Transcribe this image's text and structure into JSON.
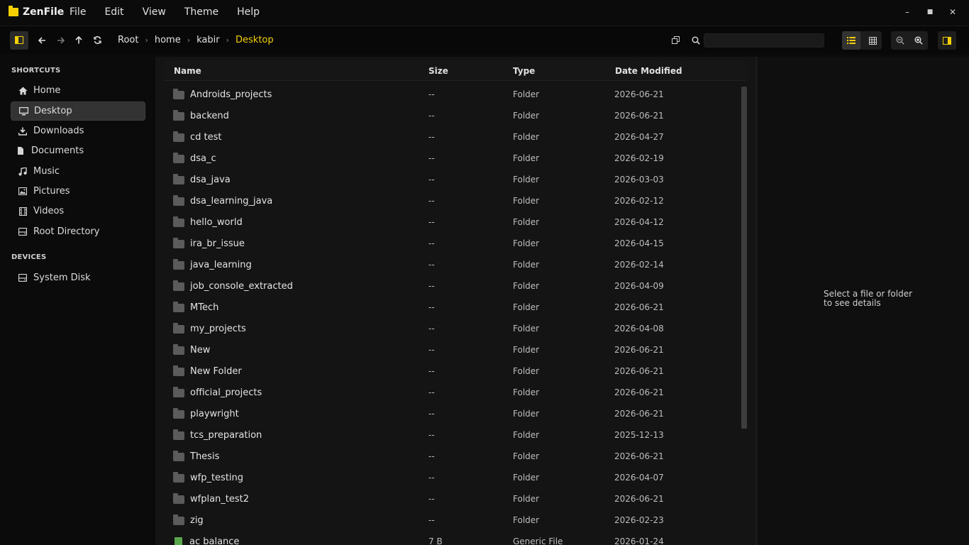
{
  "app": {
    "name": "ZenFile"
  },
  "menu": [
    "File",
    "Edit",
    "View",
    "Theme",
    "Help"
  ],
  "window_controls": {
    "minimize": "–",
    "maximize": "■",
    "close": "✕"
  },
  "breadcrumb": [
    "Root",
    "home",
    "kabir",
    "Desktop"
  ],
  "search": {
    "value": "",
    "placeholder": ""
  },
  "sidebar": {
    "shortcuts_title": "SHORTCUTS",
    "shortcuts": [
      {
        "label": "Home",
        "icon": "home-icon"
      },
      {
        "label": "Desktop",
        "icon": "desktop-icon",
        "active": true
      },
      {
        "label": "Downloads",
        "icon": "download-icon"
      },
      {
        "label": "Documents",
        "icon": "document-icon"
      },
      {
        "label": "Music",
        "icon": "music-icon"
      },
      {
        "label": "Pictures",
        "icon": "image-icon"
      },
      {
        "label": "Videos",
        "icon": "video-icon"
      },
      {
        "label": "Root Directory",
        "icon": "root-directory-icon"
      }
    ],
    "devices_title": "DEVICES",
    "devices": [
      {
        "label": "System Disk",
        "icon": "disk-icon"
      }
    ]
  },
  "list": {
    "headers": {
      "name": "Name",
      "size": "Size",
      "type": "Type",
      "date": "Date Modified"
    },
    "rows": [
      {
        "name": "Androids_projects",
        "size": "--",
        "type": "Folder",
        "date": "2026-06-21",
        "kind": "folder"
      },
      {
        "name": "backend",
        "size": "--",
        "type": "Folder",
        "date": "2026-06-21",
        "kind": "folder"
      },
      {
        "name": "cd test",
        "size": "--",
        "type": "Folder",
        "date": "2026-04-27",
        "kind": "folder"
      },
      {
        "name": "dsa_c",
        "size": "--",
        "type": "Folder",
        "date": "2026-02-19",
        "kind": "folder"
      },
      {
        "name": "dsa_java",
        "size": "--",
        "type": "Folder",
        "date": "2026-03-03",
        "kind": "folder"
      },
      {
        "name": "dsa_learning_java",
        "size": "--",
        "type": "Folder",
        "date": "2026-02-12",
        "kind": "folder"
      },
      {
        "name": "hello_world",
        "size": "--",
        "type": "Folder",
        "date": "2026-04-12",
        "kind": "folder"
      },
      {
        "name": "ira_br_issue",
        "size": "--",
        "type": "Folder",
        "date": "2026-04-15",
        "kind": "folder"
      },
      {
        "name": "java_learning",
        "size": "--",
        "type": "Folder",
        "date": "2026-02-14",
        "kind": "folder"
      },
      {
        "name": "job_console_extracted",
        "size": "--",
        "type": "Folder",
        "date": "2026-04-09",
        "kind": "folder"
      },
      {
        "name": "MTech",
        "size": "--",
        "type": "Folder",
        "date": "2026-06-21",
        "kind": "folder"
      },
      {
        "name": "my_projects",
        "size": "--",
        "type": "Folder",
        "date": "2026-04-08",
        "kind": "folder"
      },
      {
        "name": "New",
        "size": "--",
        "type": "Folder",
        "date": "2026-06-21",
        "kind": "folder"
      },
      {
        "name": "New Folder",
        "size": "--",
        "type": "Folder",
        "date": "2026-06-21",
        "kind": "folder"
      },
      {
        "name": "official_projects",
        "size": "--",
        "type": "Folder",
        "date": "2026-06-21",
        "kind": "folder"
      },
      {
        "name": "playwright",
        "size": "--",
        "type": "Folder",
        "date": "2026-06-21",
        "kind": "folder"
      },
      {
        "name": "tcs_preparation",
        "size": "--",
        "type": "Folder",
        "date": "2025-12-13",
        "kind": "folder"
      },
      {
        "name": "Thesis",
        "size": "--",
        "type": "Folder",
        "date": "2026-06-21",
        "kind": "folder"
      },
      {
        "name": "wfp_testing",
        "size": "--",
        "type": "Folder",
        "date": "2026-04-07",
        "kind": "folder"
      },
      {
        "name": "wfplan_test2",
        "size": "--",
        "type": "Folder",
        "date": "2026-06-21",
        "kind": "folder"
      },
      {
        "name": "zig",
        "size": "--",
        "type": "Folder",
        "date": "2026-02-23",
        "kind": "folder"
      },
      {
        "name": "ac balance",
        "size": "7 B",
        "type": "Generic File",
        "date": "2026-01-24",
        "kind": "file"
      }
    ]
  },
  "details": {
    "empty_message": "Select a file or folder to see details"
  },
  "colors": {
    "accent": "#f5d000",
    "background": "#141414",
    "sidebar": "#0b0b0b",
    "selected": "#333333"
  }
}
